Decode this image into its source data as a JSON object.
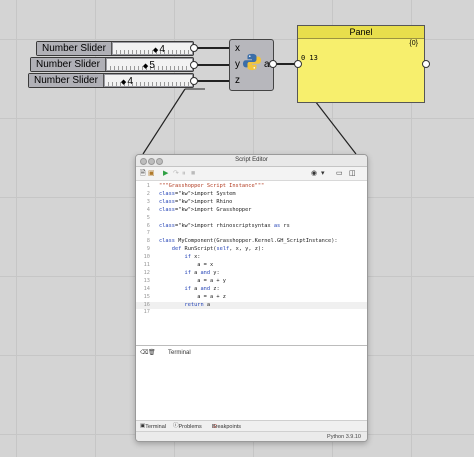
{
  "sliders": [
    {
      "label": "Number Slider",
      "value": "4"
    },
    {
      "label": "Number Slider",
      "value": "5"
    },
    {
      "label": "Number Slider",
      "value": "4"
    }
  ],
  "node": {
    "inputs": [
      "x",
      "y",
      "z"
    ],
    "output": "a",
    "icon": "python-logo-icon"
  },
  "panel": {
    "title": "Panel",
    "count": "{0}",
    "value": "0 13"
  },
  "editor": {
    "title": "Script Editor",
    "lines": [
      {
        "no": "1",
        "text": "\"\"\"Grasshopper Script Instance\"\"\""
      },
      {
        "no": "2",
        "text": "import System"
      },
      {
        "no": "3",
        "text": "import Rhino"
      },
      {
        "no": "4",
        "text": "import Grasshopper"
      },
      {
        "no": "5",
        "text": ""
      },
      {
        "no": "6",
        "text": "import rhinoscriptsyntax as rs"
      },
      {
        "no": "7",
        "text": ""
      },
      {
        "no": "8",
        "text": "class MyComponent(Grasshopper.Kernel.GH_ScriptInstance):"
      },
      {
        "no": "9",
        "text": "    def RunScript(self, x, y, z):"
      },
      {
        "no": "10",
        "text": "        if x:"
      },
      {
        "no": "11",
        "text": "            a = x"
      },
      {
        "no": "12",
        "text": "        if a and y:"
      },
      {
        "no": "13",
        "text": "            a = a + y"
      },
      {
        "no": "14",
        "text": "        if a and z:"
      },
      {
        "no": "15",
        "text": "            a = a + z"
      },
      {
        "no": "16",
        "text": "        return a"
      },
      {
        "no": "17",
        "text": ""
      }
    ],
    "terminal_label": "Terminal",
    "tabs": [
      "Terminal",
      "Problems",
      "Breakpoints"
    ],
    "status": "Python 3.9.10"
  },
  "colors": {
    "panel_bg": "#f7ef6d",
    "canvas_bg": "#d4d4d4",
    "keyword": "#1f3fb5",
    "string": "#b23a1f"
  }
}
